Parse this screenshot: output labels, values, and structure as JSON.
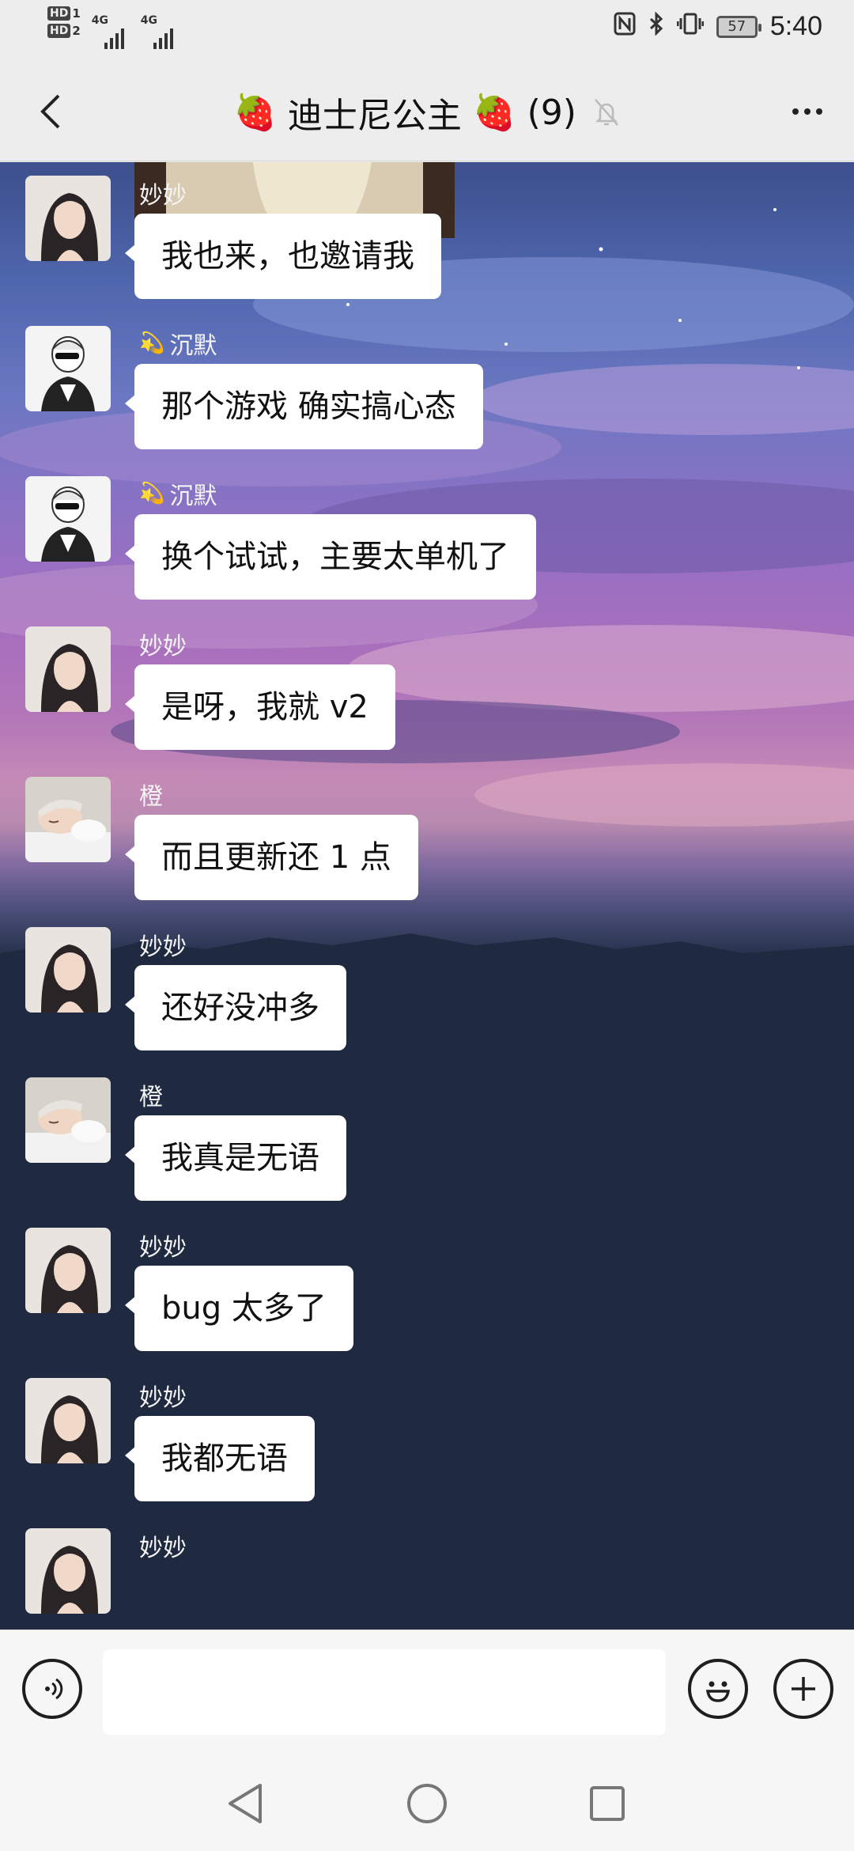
{
  "status_bar": {
    "hd1": "HD",
    "hd1_sub": "1",
    "hd2": "HD",
    "hd2_sub": "2",
    "net1": "4G",
    "net2": "4G",
    "battery": "57",
    "time": "5:40",
    "icons": [
      "nfc-icon",
      "bluetooth-icon",
      "vibrate-icon"
    ]
  },
  "header": {
    "emoji_left": "🍓",
    "title": "迪士尼公主",
    "emoji_right": "🍓",
    "member_count": "(9)"
  },
  "messages": [
    {
      "sender": "妙妙",
      "text": "我也来，也邀请我",
      "avatar": "girl"
    },
    {
      "sender": "沉默",
      "badge": "💫",
      "text": "那个游戏 确实搞心态",
      "avatar": "sketch"
    },
    {
      "sender": "沉默",
      "badge": "💫",
      "text": "换个试试，主要太单机了",
      "avatar": "sketch"
    },
    {
      "sender": "妙妙",
      "text": "是呀，我就 v2",
      "avatar": "girl"
    },
    {
      "sender": "橙",
      "text": "而且更新还 1 点",
      "avatar": "sleep"
    },
    {
      "sender": "妙妙",
      "text": "还好没冲多",
      "avatar": "girl"
    },
    {
      "sender": "橙",
      "text": "我真是无语",
      "avatar": "sleep"
    },
    {
      "sender": "妙妙",
      "text": "bug 太多了",
      "avatar": "girl"
    },
    {
      "sender": "妙妙",
      "text": "我都无语",
      "avatar": "girl"
    },
    {
      "sender": "妙妙",
      "text": "",
      "avatar": "girl"
    }
  ],
  "input": {
    "value": ""
  },
  "colors": {
    "bubble": "#ffffff",
    "chat_bg_dark": "#1f2a40",
    "bar_bg": "#f6f6f6"
  }
}
